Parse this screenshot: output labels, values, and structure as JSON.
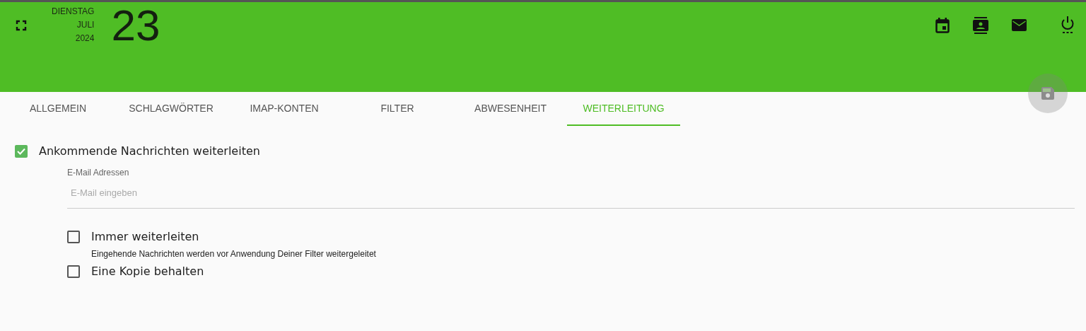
{
  "date": {
    "weekday": "DIENSTAG",
    "month": "JULI",
    "year": "2024",
    "day": "23"
  },
  "tabs": [
    {
      "label": "ALLGEMEIN",
      "selected": false
    },
    {
      "label": "SCHLAGWÖRTER",
      "selected": false
    },
    {
      "label": "IMAP-KONTEN",
      "selected": false
    },
    {
      "label": "FILTER",
      "selected": false
    },
    {
      "label": "ABWESENHEIT",
      "selected": false
    },
    {
      "label": "WEITERLEITUNG",
      "selected": true
    }
  ],
  "save_button": {
    "disabled": true
  },
  "forwarding": {
    "label": "Ankommende Nachrichten weiterleiten",
    "checked": true
  },
  "email_field": {
    "label": "E-Mail Adressen",
    "placeholder": "E-Mail eingeben"
  },
  "options": [
    {
      "label": "Immer weiterleiten",
      "hint": "Eingehende Nachrichten werden vor Anwendung Deiner Filter weitergeleitet",
      "checked": false
    },
    {
      "label": "Eine Kopie behalten",
      "checked": false
    }
  ]
}
